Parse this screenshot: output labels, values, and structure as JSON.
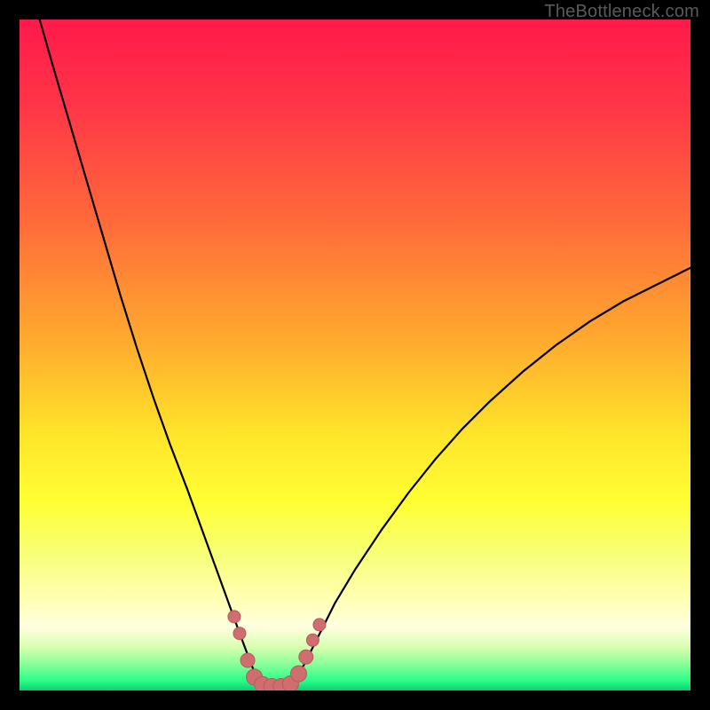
{
  "watermark": "TheBottleneck.com",
  "chart_data": {
    "type": "line",
    "title": "",
    "xlabel": "",
    "ylabel": "",
    "xlim": [
      0,
      100
    ],
    "ylim": [
      0,
      100
    ],
    "background_gradient": {
      "stops": [
        {
          "offset": 0.0,
          "color": "#ff1a4a"
        },
        {
          "offset": 0.12,
          "color": "#ff3348"
        },
        {
          "offset": 0.3,
          "color": "#ff6a3a"
        },
        {
          "offset": 0.48,
          "color": "#ffab2e"
        },
        {
          "offset": 0.62,
          "color": "#ffe52a"
        },
        {
          "offset": 0.72,
          "color": "#ffff33"
        },
        {
          "offset": 0.8,
          "color": "#f7ff7a"
        },
        {
          "offset": 0.86,
          "color": "#ffffb0"
        },
        {
          "offset": 0.905,
          "color": "#ffffe0"
        },
        {
          "offset": 0.935,
          "color": "#d8ffb0"
        },
        {
          "offset": 0.96,
          "color": "#8bff9a"
        },
        {
          "offset": 0.985,
          "color": "#2aff88"
        },
        {
          "offset": 1.0,
          "color": "#0cce74"
        }
      ]
    },
    "series": [
      {
        "name": "left-curve",
        "stroke": "#000000",
        "x": [
          3.0,
          5.0,
          7.5,
          10.0,
          12.5,
          15.0,
          17.5,
          20.0,
          22.5,
          25.0,
          27.0,
          29.0,
          31.0,
          33.0,
          34.5,
          35.5,
          36.0
        ],
        "y": [
          100.0,
          93.0,
          84.5,
          76.0,
          67.5,
          59.0,
          51.0,
          43.5,
          36.5,
          30.0,
          24.5,
          19.0,
          13.5,
          8.0,
          4.0,
          1.5,
          0.3
        ]
      },
      {
        "name": "right-curve",
        "stroke": "#000000",
        "x": [
          40.0,
          41.0,
          42.5,
          44.5,
          47.0,
          50.0,
          54.0,
          58.0,
          62.0,
          66.0,
          70.0,
          75.0,
          80.0,
          85.0,
          90.0,
          95.0,
          100.0
        ],
        "y": [
          0.3,
          1.5,
          4.0,
          8.0,
          13.0,
          18.0,
          24.0,
          29.5,
          34.5,
          39.0,
          43.0,
          47.5,
          51.5,
          55.0,
          58.0,
          60.5,
          63.0
        ]
      }
    ],
    "markers": {
      "name": "bottom-dots",
      "fill": "#cf6e6e",
      "stroke": "#b85a5a",
      "points": [
        {
          "x": 32.0,
          "y": 11.0,
          "r": 7
        },
        {
          "x": 32.8,
          "y": 8.5,
          "r": 7
        },
        {
          "x": 34.0,
          "y": 4.5,
          "r": 8
        },
        {
          "x": 35.0,
          "y": 2.0,
          "r": 9
        },
        {
          "x": 36.2,
          "y": 0.9,
          "r": 9
        },
        {
          "x": 37.6,
          "y": 0.6,
          "r": 9
        },
        {
          "x": 39.0,
          "y": 0.6,
          "r": 9
        },
        {
          "x": 40.4,
          "y": 1.0,
          "r": 9
        },
        {
          "x": 41.6,
          "y": 2.5,
          "r": 9
        },
        {
          "x": 42.7,
          "y": 5.0,
          "r": 8
        },
        {
          "x": 43.7,
          "y": 7.5,
          "r": 7
        },
        {
          "x": 44.7,
          "y": 9.8,
          "r": 7
        }
      ]
    }
  }
}
